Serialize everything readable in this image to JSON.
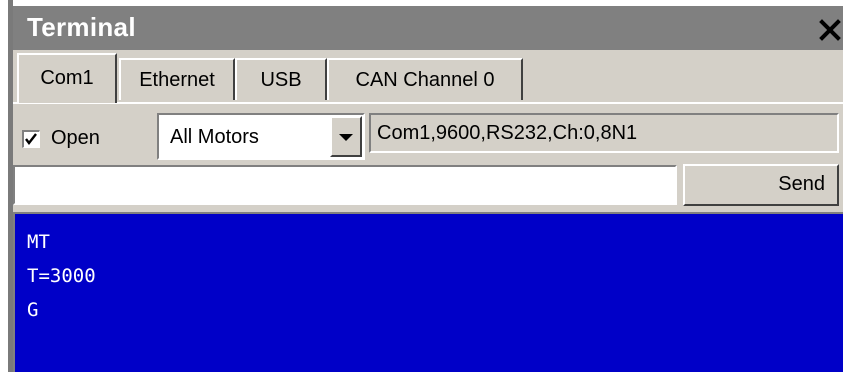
{
  "window": {
    "title": "Terminal"
  },
  "tabs": [
    {
      "label": "Com1",
      "active": true
    },
    {
      "label": "Ethernet",
      "active": false
    },
    {
      "label": "USB",
      "active": false
    },
    {
      "label": "CAN Channel 0",
      "active": false
    }
  ],
  "connection": {
    "open_label": "Open",
    "open_checked": true,
    "motor_select_value": "All Motors",
    "port_info": "Com1,9600,RS232,Ch:0,8N1"
  },
  "command": {
    "input_value": "",
    "send_label": "Send"
  },
  "output": {
    "lines": [
      "MT",
      "T=3000",
      "G"
    ]
  },
  "colors": {
    "title_bar": "#808080",
    "panel": "#d4d0c8",
    "output_background": "#0000c8",
    "output_text": "#ffffff"
  },
  "icons": {
    "close": "close-icon",
    "dropdown": "chevron-down-icon",
    "check": "checkmark-icon"
  }
}
